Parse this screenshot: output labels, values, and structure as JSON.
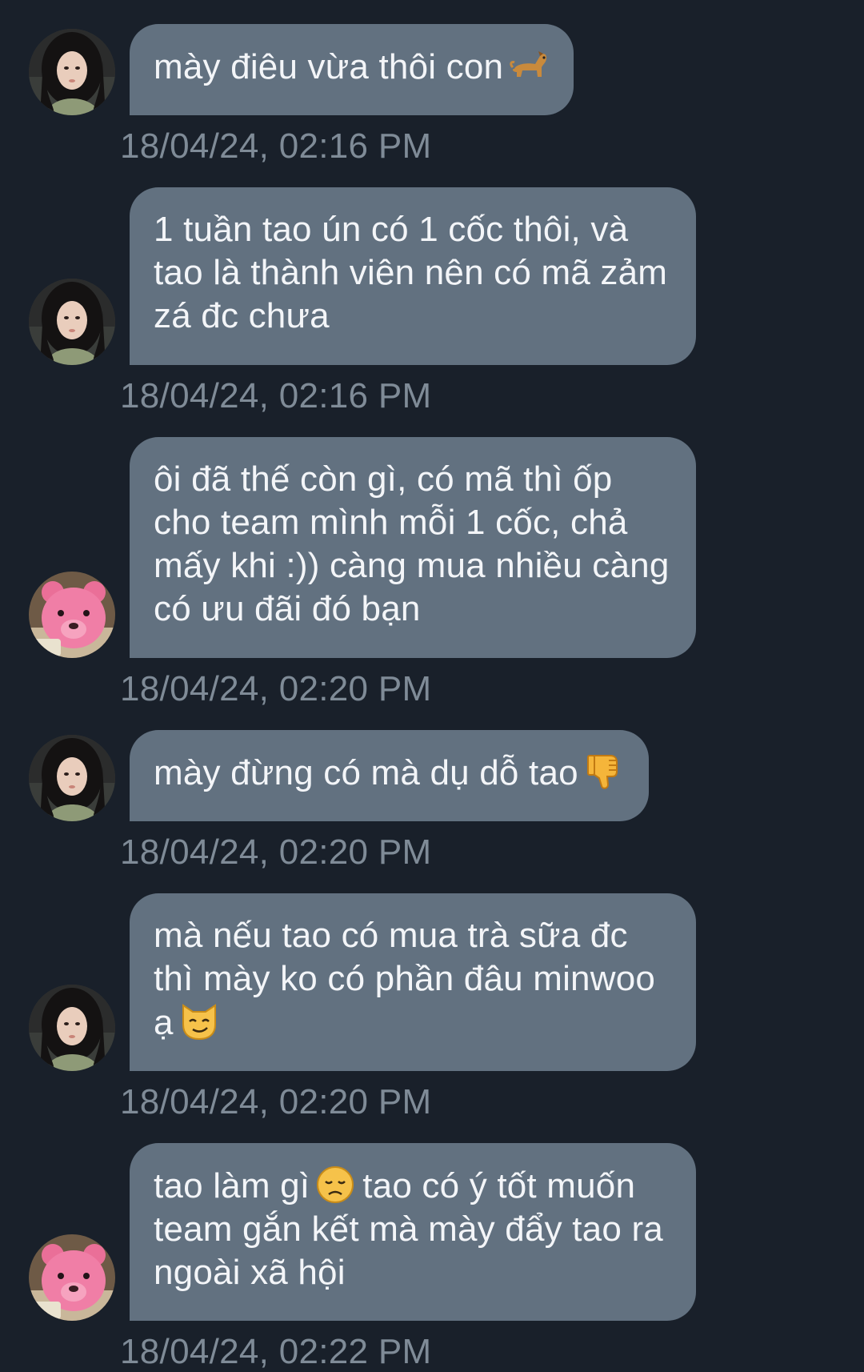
{
  "theme": {
    "background": "#19202a",
    "bubble": "#627180",
    "bubble_text": "#f3f5f8",
    "timestamp": "#7f8b97"
  },
  "messages": [
    {
      "sender_avatar": "girl-photo",
      "text": "mày điêu vừa thôi con",
      "emoji": "dog-icon",
      "time": "18/04/24, 02:16 PM"
    },
    {
      "sender_avatar": "girl-photo",
      "text": "1 tuần tao ún có 1 cốc thôi, và tao là thành viên nên có mã zảm zá đc chưa",
      "emoji": "",
      "time": "18/04/24, 02:16 PM"
    },
    {
      "sender_avatar": "pink-bear",
      "text": "ôi đã thế còn gì, có mã thì ốp cho team mình mỗi 1 cốc, chả mấy khi :)) càng mua nhiều càng có ưu đãi đó bạn",
      "emoji": "",
      "time": "18/04/24, 02:20 PM"
    },
    {
      "sender_avatar": "girl-photo",
      "text": "mày đừng có mà dụ dỗ tao",
      "emoji": "thumbs-down-icon",
      "time": "18/04/24, 02:20 PM"
    },
    {
      "sender_avatar": "girl-photo",
      "text": "mà nếu tao có mua trà sữa đc thì mày ko có phần đâu minwoo ạ",
      "emoji": "smirking-cat-icon",
      "time": "18/04/24, 02:20 PM"
    },
    {
      "sender_avatar": "pink-bear",
      "text_before": "tao làm gì",
      "emoji": "disappointed-face-icon",
      "text_after": "tao có ý tốt muốn team gắn kết mà mày đẩy tao ra ngoài xã hội",
      "time": "18/04/24, 02:22 PM"
    }
  ]
}
